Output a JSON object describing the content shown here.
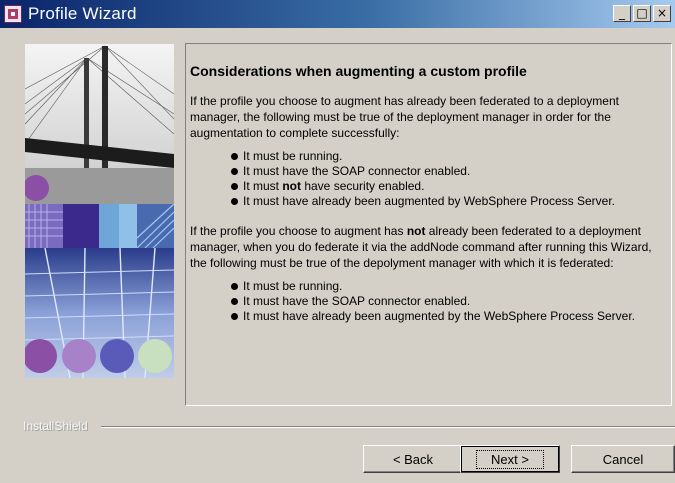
{
  "window": {
    "title": "Profile Wizard",
    "controls": [
      "_",
      "□",
      "×"
    ]
  },
  "content": {
    "heading": "Considerations when augmenting a custom profile",
    "para1": "If the profile you choose to augment has already been federated to a deployment manager, the following must be true of the deployment manager in order for the augmentation to complete successfully:",
    "list1": [
      "It must be running.",
      "It must have the SOAP connector enabled.",
      "It must not have security enabled.",
      "It must have already been augmented by WebSphere Process Server."
    ],
    "para2_a": "If the profile you choose to augment has ",
    "para2_bold": "not",
    "para2_b": " already been federated to a deployment manager, when you do federate it via the addNode command after running this Wizard, the following must be true of the depolyment manager with which it is federated:",
    "list1_item3_a": "It must ",
    "list1_item3_bold": "not",
    "list1_item3_b": " have security enabled.",
    "list2": [
      "It must be running.",
      "It must have the SOAP connector enabled.",
      "It must have already been augmented by the WebSphere Process Server."
    ]
  },
  "footer": {
    "installshield_label": "InstallShield",
    "back_label": "< Back",
    "next_label": "Next >",
    "cancel_label": "Cancel"
  },
  "colors": {
    "titlebar_start": "#0a246a",
    "titlebar_end": "#a6caf0",
    "dialog_bg": "#d4d0c8"
  }
}
